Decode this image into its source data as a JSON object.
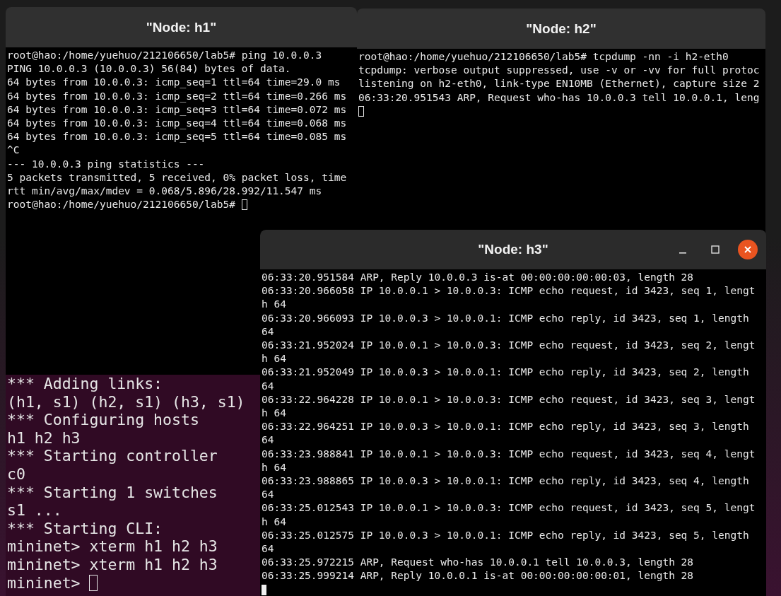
{
  "windows": [
    {
      "title": "\"Node: h1\"",
      "kind": "xterm",
      "show_controls": false,
      "cursor": {
        "filled": false,
        "new_line": false
      },
      "lines": [
        "root@hao:/home/yuehuo/212106650/lab5# ping 10.0.0.3",
        "PING 10.0.0.3 (10.0.0.3) 56(84) bytes of data.",
        "64 bytes from 10.0.0.3: icmp_seq=1 ttl=64 time=29.0 ms",
        "64 bytes from 10.0.0.3: icmp_seq=2 ttl=64 time=0.266 ms",
        "64 bytes from 10.0.0.3: icmp_seq=3 ttl=64 time=0.072 ms",
        "64 bytes from 10.0.0.3: icmp_seq=4 ttl=64 time=0.068 ms",
        "64 bytes from 10.0.0.3: icmp_seq=5 ttl=64 time=0.085 ms",
        "^C",
        "--- 10.0.0.3 ping statistics ---",
        "5 packets transmitted, 5 received, 0% packet loss, time",
        "rtt min/avg/max/mdev = 0.068/5.896/28.992/11.547 ms",
        "root@hao:/home/yuehuo/212106650/lab5#"
      ]
    },
    {
      "title": "\"Node: h2\"",
      "kind": "xterm",
      "show_controls": false,
      "cursor": {
        "filled": false,
        "new_line": true
      },
      "lines": [
        "root@hao:/home/yuehuo/212106650/lab5# tcpdump -nn -i h2-eth0",
        "tcpdump: verbose output suppressed, use -v or -vv for full protoc",
        "listening on h2-eth0, link-type EN10MB (Ethernet), capture size 2",
        "06:33:20.951543 ARP, Request who-has 10.0.0.3 tell 10.0.0.1, leng"
      ]
    },
    {
      "title": "\"Node: h3\"",
      "kind": "xterm",
      "show_controls": true,
      "cursor": {
        "filled": true,
        "new_line": true
      },
      "lines": [
        "06:33:20.951584 ARP, Reply 10.0.0.3 is-at 00:00:00:00:00:03, length 28",
        "06:33:20.966058 IP 10.0.0.1 > 10.0.0.3: ICMP echo request, id 3423, seq 1, lengt",
        "h 64",
        "06:33:20.966093 IP 10.0.0.3 > 10.0.0.1: ICMP echo reply, id 3423, seq 1, length",
        "64",
        "06:33:21.952024 IP 10.0.0.1 > 10.0.0.3: ICMP echo request, id 3423, seq 2, lengt",
        "h 64",
        "06:33:21.952049 IP 10.0.0.3 > 10.0.0.1: ICMP echo reply, id 3423, seq 2, length",
        "64",
        "06:33:22.964228 IP 10.0.0.1 > 10.0.0.3: ICMP echo request, id 3423, seq 3, lengt",
        "h 64",
        "06:33:22.964251 IP 10.0.0.3 > 10.0.0.1: ICMP echo reply, id 3423, seq 3, length",
        "64",
        "06:33:23.988841 IP 10.0.0.1 > 10.0.0.3: ICMP echo request, id 3423, seq 4, lengt",
        "h 64",
        "06:33:23.988865 IP 10.0.0.3 > 10.0.0.1: ICMP echo reply, id 3423, seq 4, length",
        "64",
        "06:33:25.012543 IP 10.0.0.1 > 10.0.0.3: ICMP echo request, id 3423, seq 5, lengt",
        "h 64",
        "06:33:25.012575 IP 10.0.0.3 > 10.0.0.1: ICMP echo reply, id 3423, seq 5, length",
        "64",
        "06:33:25.972215 ARP, Request who-has 10.0.0.1 tell 10.0.0.3, length 28",
        "06:33:25.999214 ARP, Reply 10.0.0.1 is-at 00:00:00:00:00:01, length 28"
      ]
    },
    {
      "kind": "console",
      "cursor": {
        "filled": false,
        "new_line": false
      },
      "lines": [
        "*** Adding links:",
        "(h1, s1) (h2, s1) (h3, s1)",
        "*** Configuring hosts",
        "h1 h2 h3",
        "*** Starting controller",
        "c0",
        "*** Starting 1 switches",
        "s1 ...",
        "*** Starting CLI:",
        "mininet> xterm h1 h2 h3",
        "mininet> xterm h1 h2 h3",
        "mininet>"
      ]
    }
  ]
}
